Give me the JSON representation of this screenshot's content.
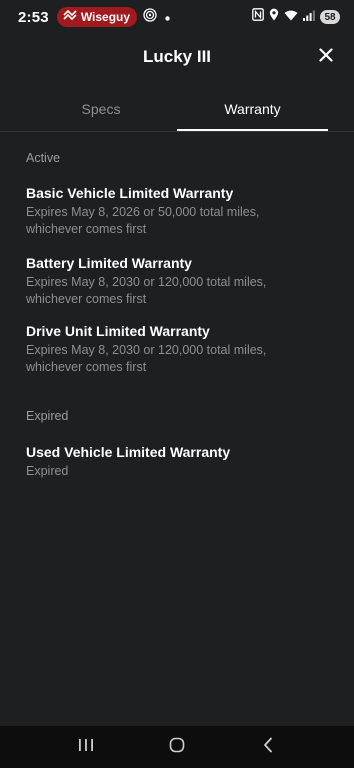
{
  "status_bar": {
    "time": "2:53",
    "notification_app": "Wiseguy",
    "battery": "58"
  },
  "header": {
    "title": "Lucky III"
  },
  "tabs": [
    {
      "label": "Specs",
      "active": false
    },
    {
      "label": "Warranty",
      "active": true
    }
  ],
  "sections": {
    "active": {
      "label": "Active",
      "items": [
        {
          "title": "Basic Vehicle Limited Warranty",
          "line1": "Expires May 8, 2026 or 50,000 total miles,",
          "line2": "whichever comes first"
        },
        {
          "title": "Battery Limited Warranty",
          "line1": "Expires May 8, 2030 or 120,000 total miles,",
          "line2": "whichever comes first"
        },
        {
          "title": "Drive Unit Limited Warranty",
          "line1": "Expires May 8, 2030 or 120,000 total miles,",
          "line2": "whichever comes first"
        }
      ]
    },
    "expired": {
      "label": "Expired",
      "items": [
        {
          "title": "Used Vehicle Limited Warranty",
          "line1": "Expired"
        }
      ]
    }
  },
  "colors": {
    "background": "#1e1f21",
    "notification_pill": "#a11a1d",
    "text_primary": "#ffffff",
    "text_secondary": "#8d8f93"
  },
  "icons": {
    "close": "close-icon",
    "nav_recent": "recent-apps-icon",
    "nav_home": "home-icon",
    "nav_back": "back-icon"
  }
}
